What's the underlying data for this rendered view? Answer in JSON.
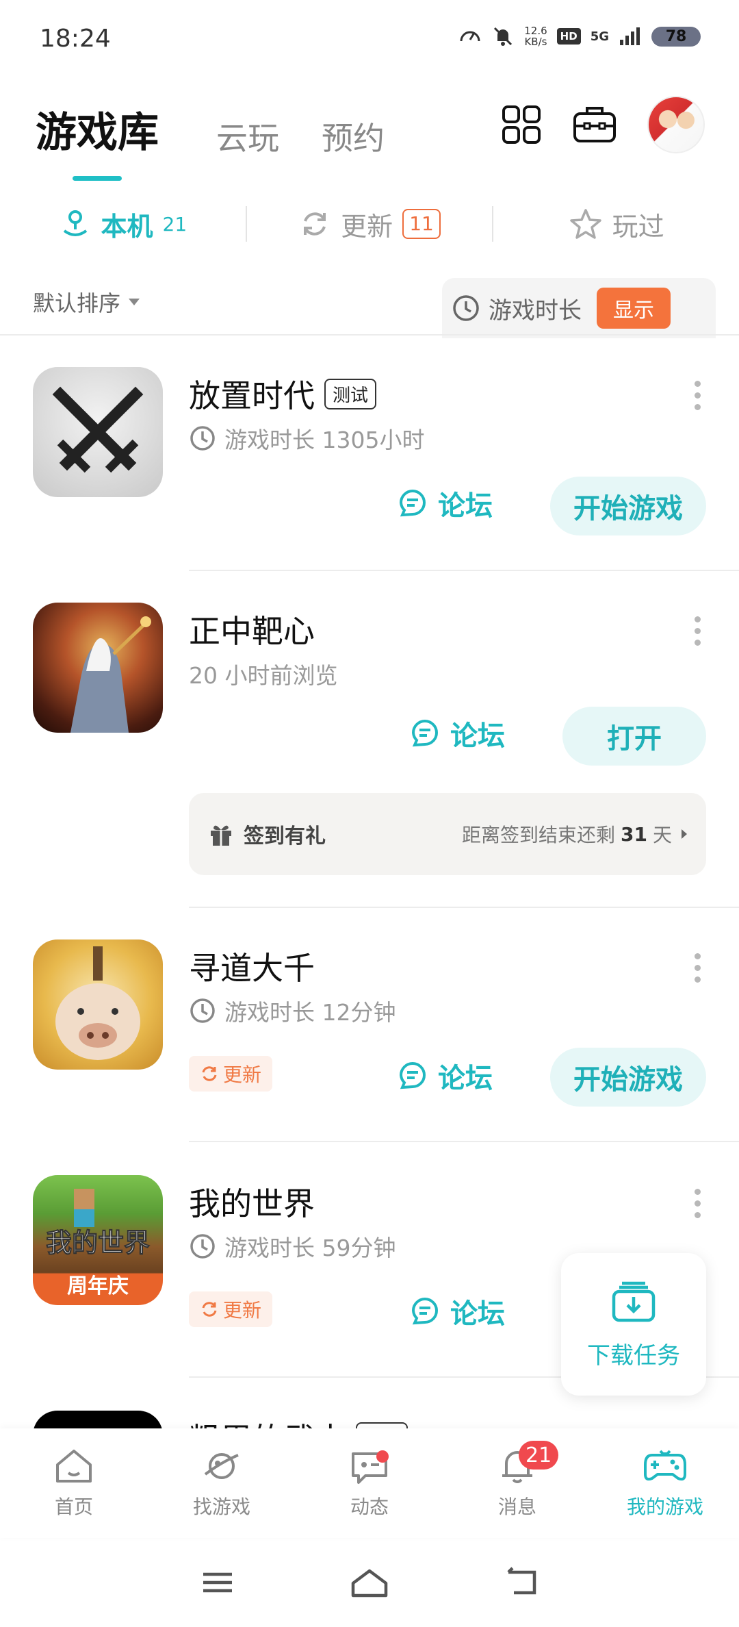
{
  "status_bar": {
    "time": "18:24",
    "net_speed_value": "12.6",
    "net_speed_unit": "KB/s",
    "hd": "HD",
    "network": "5G",
    "battery": "78"
  },
  "header": {
    "tabs": [
      {
        "label": "游戏库",
        "active": true
      },
      {
        "label": "云玩",
        "active": false
      },
      {
        "label": "预约",
        "active": false
      }
    ]
  },
  "sub_tabs": [
    {
      "label": "本机",
      "count": "21",
      "icon": "device-icon",
      "active": true
    },
    {
      "label": "更新",
      "count": "11",
      "icon": "refresh-icon",
      "active": false
    },
    {
      "label": "玩过",
      "count": "",
      "icon": "star-icon",
      "active": false
    }
  ],
  "sort": {
    "label": "默认排序",
    "play_time_label": "游戏时长",
    "show_button": "显示"
  },
  "games": [
    {
      "title": "放置时代",
      "tag": "测试",
      "subtitle": "游戏时长 1305小时",
      "forum": "论坛",
      "action": "开始游戏"
    },
    {
      "title": "正中靶心",
      "subtitle": "20 小时前浏览",
      "forum": "论坛",
      "action": "打开",
      "sign_in": {
        "label": "签到有礼",
        "prefix": "距离签到结束还剩",
        "days": "31",
        "suffix": "天"
      }
    },
    {
      "title": "寻道大千",
      "subtitle": "游戏时长 12分钟",
      "update": "更新",
      "forum": "论坛",
      "action": "开始游戏"
    },
    {
      "title": "我的世界",
      "subtitle": "游戏时长 59分钟",
      "update": "更新",
      "forum": "论坛",
      "icon_text_top": "我的世界",
      "icon_text_bottom": "周年庆"
    },
    {
      "title": "粗眉的武夫",
      "tag": "测试"
    }
  ],
  "download_task": {
    "label": "下载任务"
  },
  "bottom_nav": [
    {
      "label": "首页",
      "icon": "home-icon"
    },
    {
      "label": "找游戏",
      "icon": "planet-icon"
    },
    {
      "label": "动态",
      "icon": "chat-icon"
    },
    {
      "label": "消息",
      "icon": "bell-icon",
      "badge": "21"
    },
    {
      "label": "我的游戏",
      "icon": "gamepad-icon",
      "active": true
    }
  ],
  "colors": {
    "accent": "#1fb8c0",
    "orange": "#f4733c",
    "badge_red": "#f0494e"
  }
}
